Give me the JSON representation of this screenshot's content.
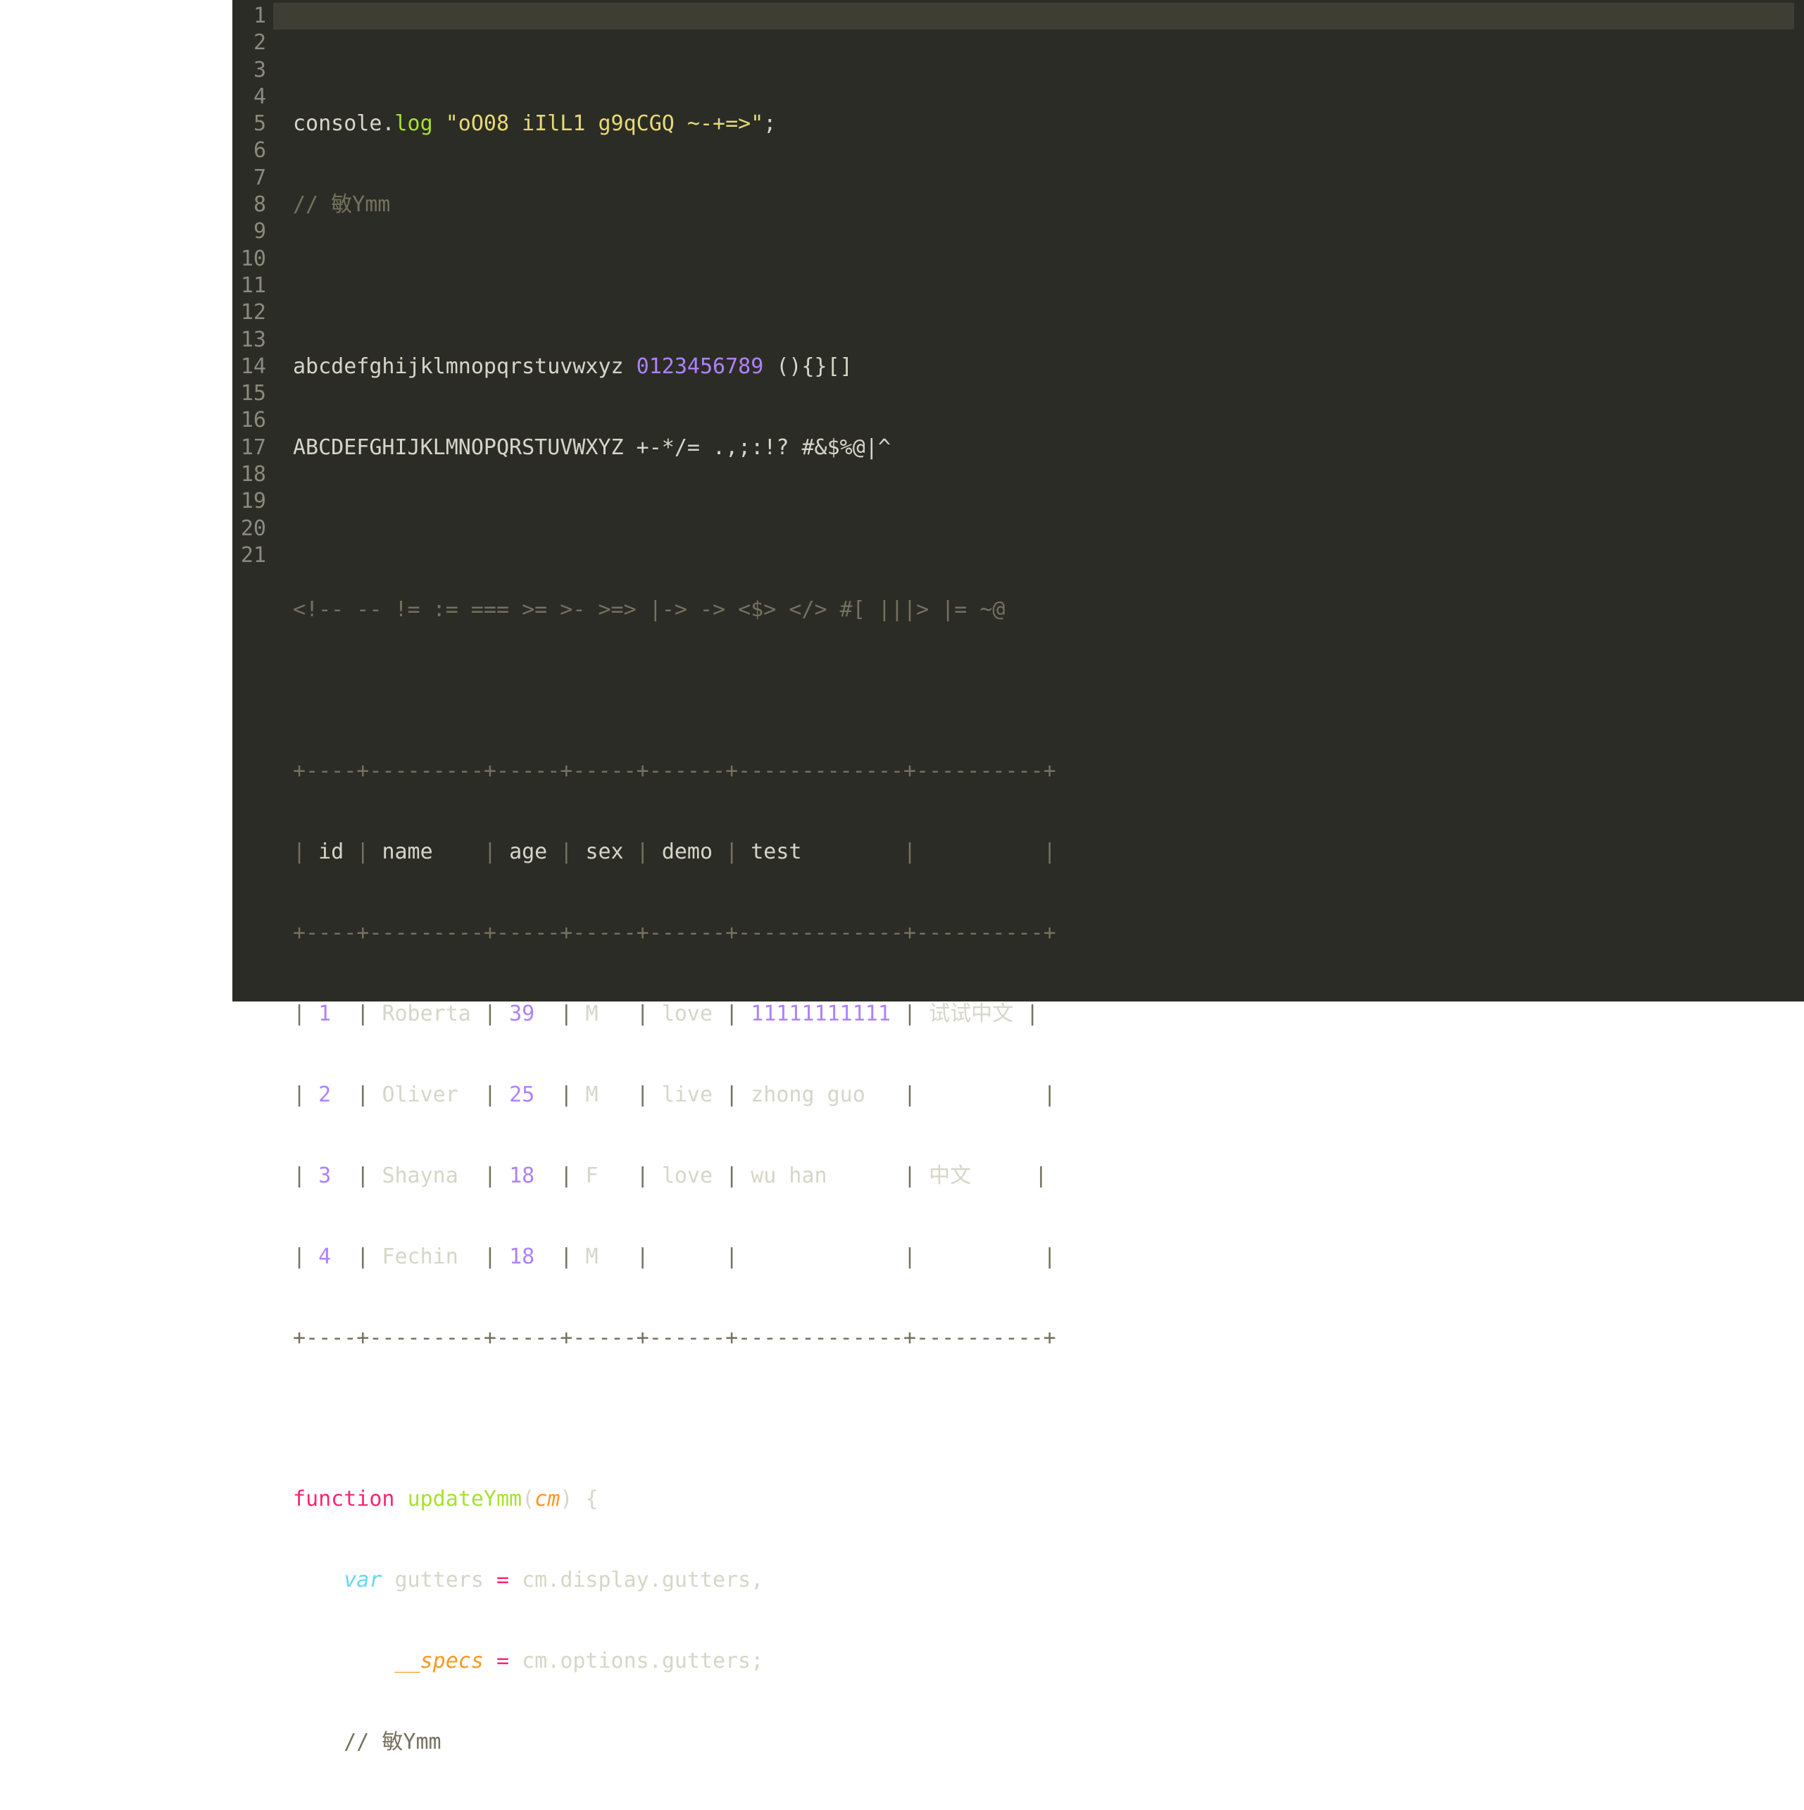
{
  "line_count": 21,
  "lines": {
    "l1": {
      "obj": "console",
      "dot": ".",
      "method": "log",
      "sp": " ",
      "str": "\"oO08 iIlL1 g9qCGQ ~-+=>\"",
      "semi": ";"
    },
    "l2": {
      "comment": "// 敏Ymm"
    },
    "l3": {
      "blank": ""
    },
    "l4": {
      "txt1": "abcdefghijklmnopqrstuvwxyz ",
      "num": "0123456789",
      "txt2": " (){}[]"
    },
    "l5": {
      "txt": "ABCDEFGHIJKLMNOPQRSTUVWXYZ +-*/= .,;:!? #&$%@|^"
    },
    "l6": {
      "blank": ""
    },
    "l7": {
      "comment": "<!-- -- != := === >= >- >=> |-> -> <$> </> #[ |||> |= ~@"
    },
    "l8": {
      "blank": ""
    },
    "l9": {
      "rule": "+----+---------+-----+-----+------+-------------+----------+"
    },
    "l10": {
      "c0": "| ",
      "h0": "id",
      "c1": " | ",
      "h1": "name   ",
      "c2": " | ",
      "h2": "age",
      "c3": " | ",
      "h3": "sex",
      "c4": " | ",
      "h4": "demo",
      "c5": " | ",
      "h5": "test       ",
      "c6": " | ",
      "h6": "        ",
      "c7": " |"
    },
    "l11": {
      "rule": "+----+---------+-----+-----+------+-------------+----------+"
    },
    "l12": {
      "c0": "| ",
      "n": "1 ",
      "c1": " | ",
      "v1": "Roberta",
      "c2": " | ",
      "n2": "39 ",
      "c3": " | ",
      "v3": "M  ",
      "c4": " | ",
      "v4": "love",
      "c5": " | ",
      "n5": "11111111111",
      "c6": " | ",
      "v6": "试试中文",
      "c7": " |"
    },
    "l13": {
      "c0": "| ",
      "n": "2 ",
      "c1": " | ",
      "v1": "Oliver ",
      "c2": " | ",
      "n2": "25 ",
      "c3": " | ",
      "v3": "M  ",
      "c4": " | ",
      "v4": "live",
      "c5": " | ",
      "v5": "zhong guo  ",
      "c6": " | ",
      "v6": "        ",
      "c7": " |"
    },
    "l14": {
      "c0": "| ",
      "n": "3 ",
      "c1": " | ",
      "v1": "Shayna ",
      "c2": " | ",
      "n2": "18 ",
      "c3": " | ",
      "v3": "F  ",
      "c4": " | ",
      "v4": "love",
      "c5": " | ",
      "v5": "wu han     ",
      "c6": " | ",
      "v6": "中文    ",
      "c7": " |"
    },
    "l15": {
      "c0": "| ",
      "n": "4 ",
      "c1": " | ",
      "v1": "Fechin ",
      "c2": " | ",
      "n2": "18 ",
      "c3": " | ",
      "v3": "M  ",
      "c4": " | ",
      "v4": "    ",
      "c5": " | ",
      "v5": "           ",
      "c6": " | ",
      "v6": "        ",
      "c7": " |"
    },
    "l16": {
      "rule": "+----+---------+-----+-----+------+-------------+----------+"
    },
    "l17": {
      "blank": ""
    },
    "l18": {
      "kw": "function",
      "sp1": " ",
      "fname": "updateYmm",
      "paren_o": "(",
      "arg": "cm",
      "paren_c": ")",
      "sp2": " ",
      "brace": "{"
    },
    "l19": {
      "indent": "    ",
      "decl": "var",
      "sp1": " ",
      "id": "gutters",
      "sp2": " ",
      "eq": "=",
      "sp3": " ",
      "o1": "cm",
      "d1": ".",
      "o2": "display",
      "d2": ".",
      "o3": "gutters",
      "comma": ","
    },
    "l20": {
      "indent": "        ",
      "id": "__specs",
      "sp2": " ",
      "eq": "=",
      "sp3": " ",
      "o1": "cm",
      "d1": ".",
      "o2": "options",
      "d2": ".",
      "o3": "gutters",
      "semi": ";"
    },
    "l21": {
      "indent": "    ",
      "comment": "// 敏Ymm"
    }
  }
}
